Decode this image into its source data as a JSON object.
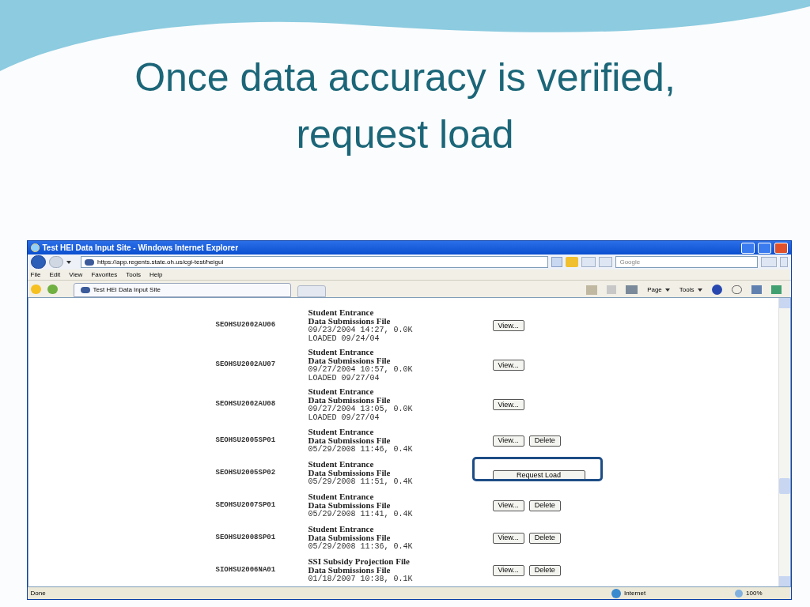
{
  "slide": {
    "title": "Once data accuracy is verified, request load"
  },
  "window": {
    "title": "Test HEI Data Input Site - Windows Internet Explorer"
  },
  "address_bar": {
    "url": "https://app.regents.state.oh.us/cgi-test/heigui"
  },
  "search": {
    "placeholder": "Google"
  },
  "menu": [
    "File",
    "Edit",
    "View",
    "Favorites",
    "Tools",
    "Help"
  ],
  "tabs": [
    {
      "label": "Test HEI Data Input Site",
      "selected": true
    }
  ],
  "command_bar": [
    "Page",
    "Tools"
  ],
  "content": {
    "rows": [
      {
        "id": "SEOHSU2002AU06",
        "lines": [
          "Student Entrance",
          "Data Submissions File"
        ],
        "details": [
          "09/23/2004 14:27, 0.0K",
          "LOADED 09/24/04"
        ],
        "buttons": [
          "View..."
        ],
        "request_load": null
      },
      {
        "id": "SEOHSU2002AU07",
        "lines": [
          "Student Entrance",
          "Data Submissions File"
        ],
        "details": [
          "09/27/2004 10:57, 0.0K",
          "LOADED 09/27/04"
        ],
        "buttons": [
          "View..."
        ],
        "request_load": null
      },
      {
        "id": "SEOHSU2002AU08",
        "lines": [
          "Student Entrance",
          "Data Submissions File"
        ],
        "details": [
          "09/27/2004 13:05, 0.0K",
          "LOADED 09/27/04"
        ],
        "buttons": [
          "View..."
        ],
        "request_load": null
      },
      {
        "id": "SEOHSU2005SP01",
        "lines": [
          "Student Entrance",
          "Data Submissions File"
        ],
        "details": [
          "05/29/2008 11:46, 0.4K"
        ],
        "buttons": [
          "View...",
          "Delete"
        ],
        "request_load": null
      },
      {
        "id": "SEOHSU2005SP02",
        "lines": [
          "Student Entrance",
          "Data Submissions File"
        ],
        "details": [
          "05/29/2008 11:51, 0.4K"
        ],
        "buttons": [],
        "request_load": {
          "label": "Request Load",
          "highlighted": true
        }
      },
      {
        "id": "SEOHSU2007SP01",
        "lines": [
          "Student Entrance",
          "Data Submissions File"
        ],
        "details": [
          "05/29/2008 11:41, 0.4K"
        ],
        "buttons": [
          "View...",
          "Delete"
        ],
        "request_load": null
      },
      {
        "id": "SEOHSU2008SP01",
        "lines": [
          "Student Entrance",
          "Data Submissions File"
        ],
        "details": [
          "05/29/2008 11:36, 0.4K"
        ],
        "buttons": [
          "View...",
          "Delete"
        ],
        "request_load": null
      },
      {
        "id": "SIOHSU2006NA01",
        "lines": [
          "SSI Subsidy Projection File",
          "Data Submissions File"
        ],
        "details": [
          "01/18/2007 10:38, 0.1K"
        ],
        "buttons": [
          "View...",
          "Delete"
        ],
        "request_load": null
      }
    ]
  },
  "status_bar": {
    "text": "Done",
    "zone": "Internet",
    "zoom": "100%"
  }
}
